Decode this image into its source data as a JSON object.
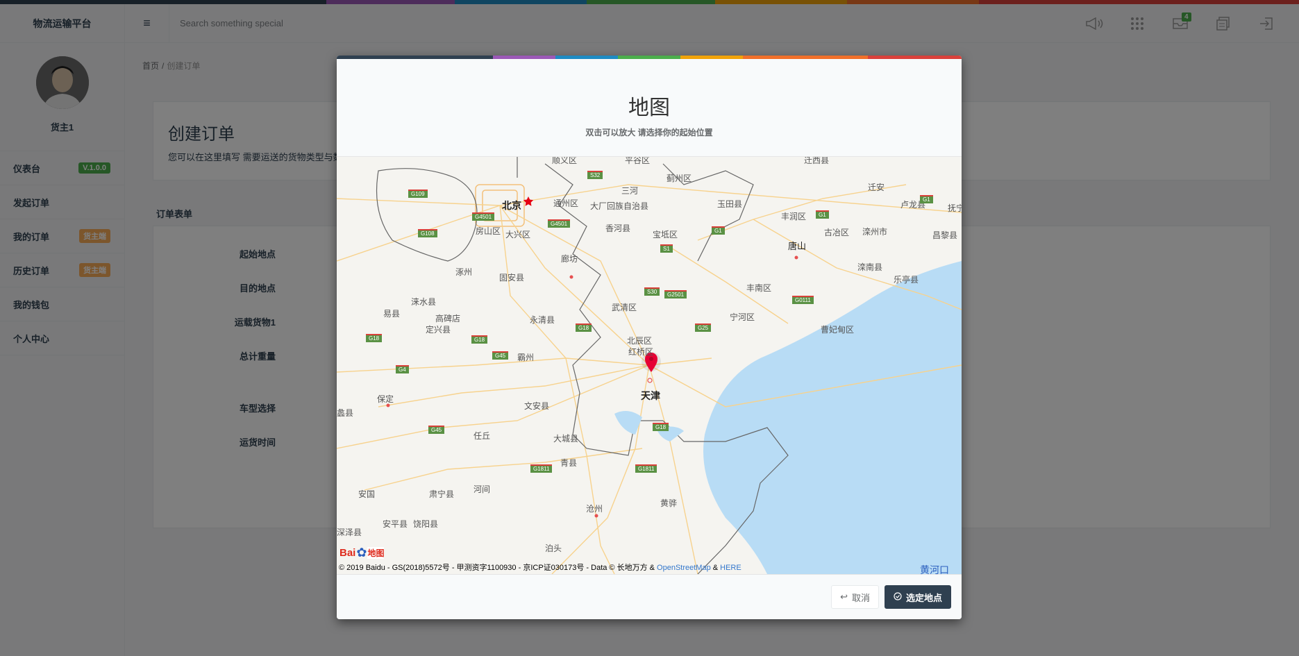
{
  "colors": {
    "stripe": [
      "#2f4050",
      "#9b59b6",
      "#1e8bc3",
      "#4cae4c",
      "#f0a30a",
      "#f0702a",
      "#d9413b"
    ],
    "primary": "#2f4050",
    "green_badge": "#4cae4c",
    "orange_badge": "#f8ac59",
    "sea": "#b8dcf5"
  },
  "app": {
    "brand": "物流运输平台"
  },
  "profile": {
    "name": "货主1"
  },
  "sidebar": {
    "items": [
      {
        "label": "仪表台",
        "badge": "V.1.0.0",
        "badge_color": "green"
      },
      {
        "label": "发起订单"
      },
      {
        "label": "我的订单",
        "badge": "货主端",
        "badge_color": "orange"
      },
      {
        "label": "历史订单",
        "badge": "货主端",
        "badge_color": "orange"
      },
      {
        "label": "我的钱包"
      },
      {
        "label": "个人中心"
      }
    ]
  },
  "header": {
    "menu_icon": "hamburger-icon",
    "search_placeholder": "Search something special",
    "icons": [
      "megaphone-icon",
      "grid-icon",
      "mail-icon",
      "stack-icon",
      "logout-icon"
    ],
    "mail_count": "4"
  },
  "breadcrumb": {
    "home": "首页",
    "sep": "/",
    "current": "创建订单"
  },
  "page": {
    "title": "创建订单",
    "description": "您可以在这里填写 需要运送的货物类型与数"
  },
  "form": {
    "title": "订单表单",
    "labels": [
      "起始地点",
      "目的地点",
      "运载货物1",
      "总计重量",
      "车型选择",
      "运货时间"
    ]
  },
  "modal": {
    "title": "地图",
    "subtitle": "双击可以放大 请选择你的起始位置",
    "cancel_label": "取消",
    "confirm_label": "选定地点",
    "cancel_icon": "reply-icon",
    "confirm_icon": "check-circle-icon"
  },
  "map": {
    "logo_text_1": "Bai",
    "logo_text_2": "地图",
    "copyright_prefix": "© 2019 Baidu - GS(2018)5572号 - 甲测资字1100930 - 京ICP证030173号 - Data © 长地万方 & ",
    "osm_link": "OpenStreetMap",
    "amp": " & ",
    "here_link": "HERE",
    "cities": [
      "北京",
      "天津"
    ],
    "places": [
      "顺义区",
      "平谷区",
      "迁西县",
      "蓟州区",
      "三河",
      "迁安",
      "通州区",
      "大厂回族自治县",
      "玉田县",
      "卢龙县",
      "抚宁",
      "丰润区",
      "古冶区",
      "滦州市",
      "昌黎县",
      "房山区",
      "大兴区",
      "香河县",
      "宝坻区",
      "唐山",
      "廊坊",
      "涿州",
      "固安县",
      "丰南区",
      "滦南县",
      "乐亭县",
      "易县",
      "涞水县",
      "高碑店",
      "定兴县",
      "永清县",
      "武清区",
      "宁河区",
      "曹妃甸区",
      "北辰区",
      "红桥区",
      "霸州",
      "保定",
      "文安县",
      "任丘",
      "大城县",
      "青县",
      "安国",
      "肃宁县",
      "河间",
      "沧州",
      "黄骅",
      "安平县",
      "饶阳县",
      "泊头",
      "深泽县",
      "蠡县"
    ],
    "roads": [
      "G109",
      "G4501",
      "G108",
      "G4501",
      "S32",
      "G1",
      "G1",
      "G1",
      "S1",
      "S30",
      "G2501",
      "G0111",
      "G18",
      "G18",
      "G18",
      "G45",
      "G4",
      "G25",
      "G45",
      "G18",
      "G1811",
      "G1811"
    ],
    "sea_label": "黄河口"
  }
}
